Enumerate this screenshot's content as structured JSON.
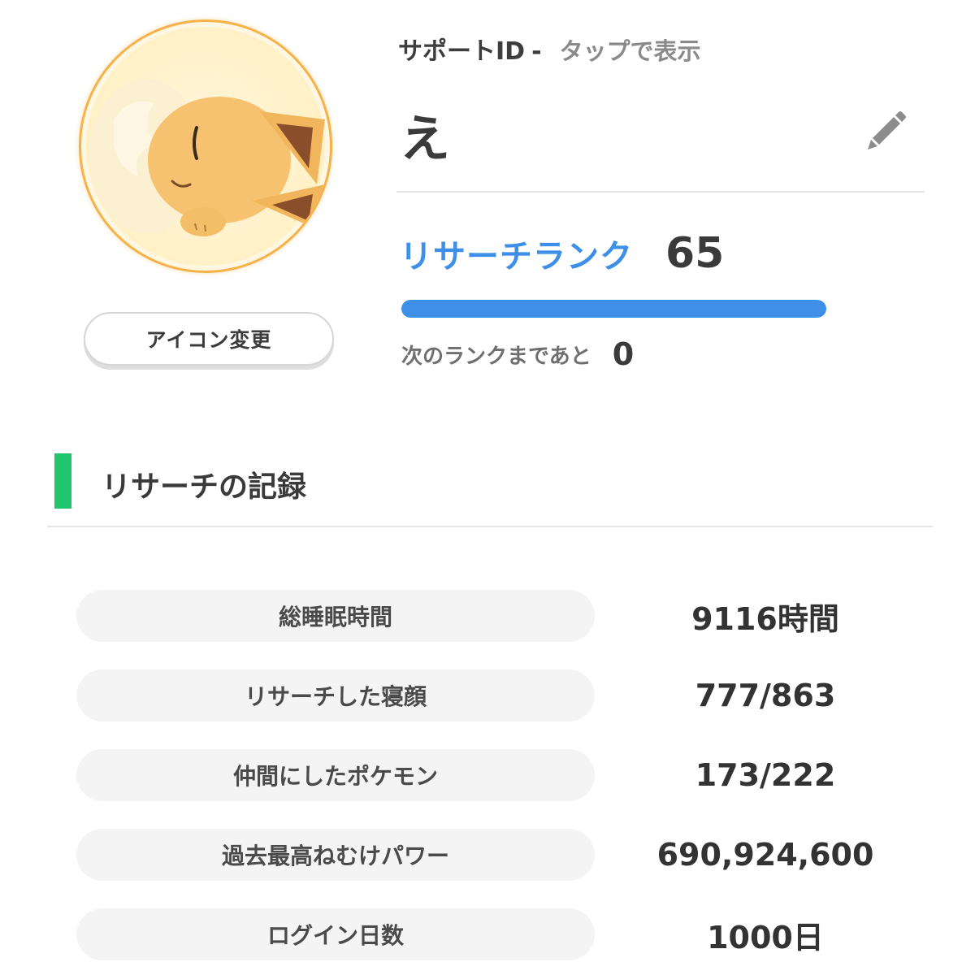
{
  "profile": {
    "support_id_label": "サポートID",
    "support_id_separator": "-",
    "support_id_tap": "タップで表示",
    "name": "え",
    "icon_change_label": "アイコン変更",
    "avatar_icon": "sleeping-eevee-avatar",
    "edit_icon": "pencil-icon"
  },
  "rank": {
    "label": "リサーチランク",
    "value": "65",
    "progress_fraction": 1.0,
    "next_label": "次のランクまであと",
    "next_value": "0"
  },
  "section": {
    "title": "リサーチの記録",
    "accent_color": "#23c46e"
  },
  "stats": [
    {
      "label": "総睡眠時間",
      "value": "9116時間"
    },
    {
      "label": "リサーチした寝顔",
      "value": "777/863"
    },
    {
      "label": "仲間にしたポケモン",
      "value": "173/222"
    },
    {
      "label": "過去最高ねむけパワー",
      "value": "690,924,600"
    },
    {
      "label": "ログイン日数",
      "value": "1000日"
    }
  ],
  "colors": {
    "rank_blue": "#3d8fe8",
    "avatar_ring": "#f5b24a"
  }
}
